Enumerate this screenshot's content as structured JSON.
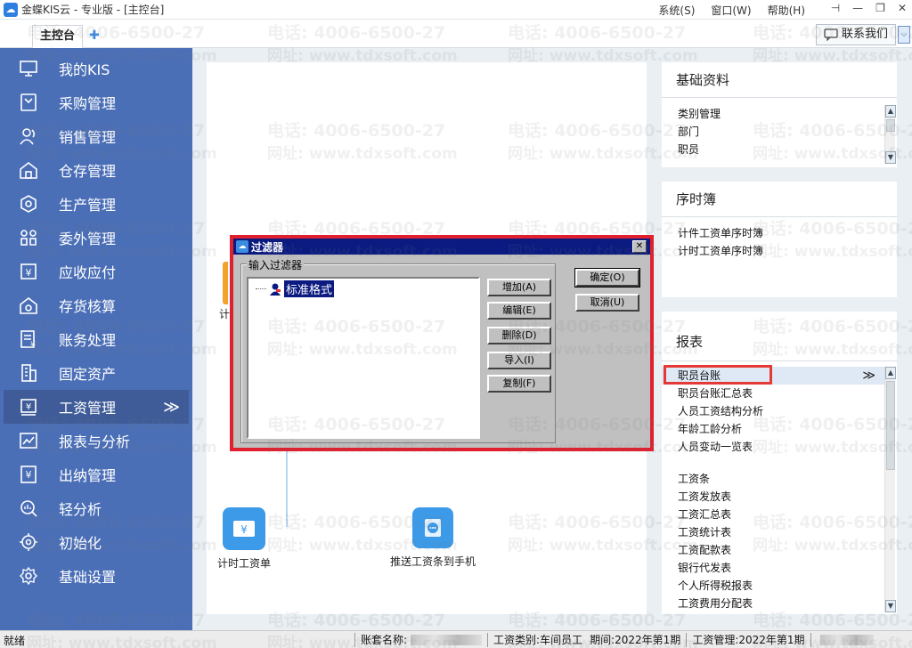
{
  "window": {
    "title": "金蝶KIS云 - 专业版 - [主控台]",
    "logo_glyph": "☁",
    "menus": [
      "系统(S)",
      "窗口(W)",
      "帮助(H)"
    ],
    "controls": [
      "⊣",
      "—",
      "❐",
      "✕"
    ]
  },
  "tabs": {
    "main": "主控台",
    "add": "✚",
    "contact": "联系我们",
    "collapse": "⌵"
  },
  "sidebar": {
    "items": [
      {
        "label": "我的KIS",
        "icon": "monitor-icon"
      },
      {
        "label": "采购管理",
        "icon": "purchase-icon"
      },
      {
        "label": "销售管理",
        "icon": "sales-icon"
      },
      {
        "label": "仓存管理",
        "icon": "warehouse-icon"
      },
      {
        "label": "生产管理",
        "icon": "production-icon"
      },
      {
        "label": "委外管理",
        "icon": "outsource-icon"
      },
      {
        "label": "应收应付",
        "icon": "receivable-icon"
      },
      {
        "label": "存货核算",
        "icon": "inventory-icon"
      },
      {
        "label": "账务处理",
        "icon": "accounting-icon"
      },
      {
        "label": "固定资产",
        "icon": "asset-icon"
      },
      {
        "label": "工资管理",
        "icon": "salary-icon",
        "active": true
      },
      {
        "label": "报表与分析",
        "icon": "report-icon"
      },
      {
        "label": "出纳管理",
        "icon": "cashier-icon"
      },
      {
        "label": "轻分析",
        "icon": "analysis-icon"
      },
      {
        "label": "初始化",
        "icon": "init-icon"
      },
      {
        "label": "基础设置",
        "icon": "settings-icon"
      }
    ],
    "active_chevron": "≫"
  },
  "workspace": {
    "partial_label": "计",
    "node_hourly": "计时工资单",
    "node_push": "推送工资条到手机",
    "hourly_icon_glyph": "¥"
  },
  "panels": {
    "basic": {
      "title": "基础资料",
      "items": [
        "类别管理",
        "部门",
        "职员",
        "币别"
      ]
    },
    "timesheet": {
      "title": "序时簿",
      "items": [
        "计件工资单序时簿",
        "计时工资单序时簿"
      ]
    },
    "reports": {
      "title": "报表",
      "group1": [
        "职员台账",
        "职员台账汇总表",
        "人员工资结构分析",
        "年龄工龄分析",
        "人员变动一览表"
      ],
      "group2": [
        "工资条",
        "工资发放表",
        "工资汇总表",
        "工资统计表",
        "工资配款表",
        "银行代发表",
        "个人所得税报表",
        "工资费用分配表"
      ],
      "selected_chevron": "≫"
    }
  },
  "dialog": {
    "title": "过滤器",
    "close": "✕",
    "group_label": "输入过滤器",
    "item": "标准格式",
    "buttons": {
      "add": "增加(A)",
      "edit": "编辑(E)",
      "delete": "删除(D)",
      "import": "导入(I)",
      "copy": "复制(F)",
      "ok": "确定(O)",
      "cancel": "取消(U)"
    }
  },
  "status": {
    "ready": "就绪",
    "account_label": "账套名称:",
    "salary_type": "工资类别:车间员工",
    "period": "期间:2022年第1期",
    "salary_mgmt": "工资管理:2022年第1期"
  },
  "watermark": {
    "phone": "电话: 4006-6500-27",
    "site": "网址: www.tdxsoft.com"
  },
  "colors": {
    "sidebar": "#4b6fb7",
    "accent": "#3d9ae8",
    "dialog_title": "#0a1a80",
    "highlight": "#e53935"
  }
}
